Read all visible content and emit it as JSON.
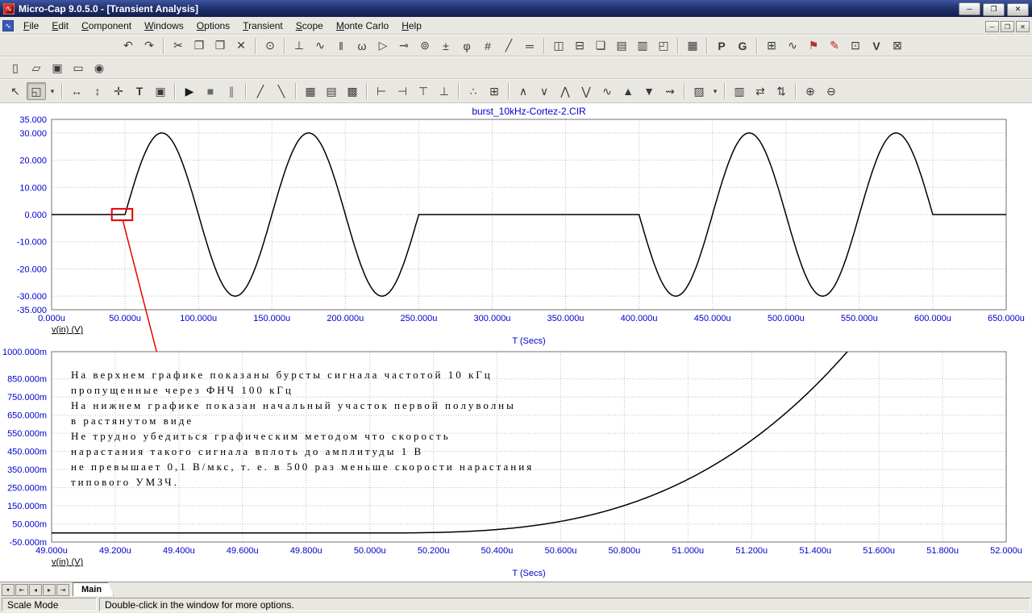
{
  "window": {
    "title": "Micro-Cap 9.0.5.0 - [Transient Analysis]",
    "icon_glyph": "∿",
    "mdi_icon_glyph": "∿",
    "controls": [
      {
        "name": "minimize",
        "glyph": "─"
      },
      {
        "name": "restore",
        "glyph": "❐"
      },
      {
        "name": "close",
        "glyph": "✕"
      }
    ],
    "mdi_controls": [
      {
        "name": "mdi-minimize",
        "glyph": "─"
      },
      {
        "name": "mdi-restore",
        "glyph": "❐"
      },
      {
        "name": "mdi-close",
        "glyph": "✕"
      }
    ]
  },
  "menubar": {
    "items": [
      "File",
      "Edit",
      "Component",
      "Windows",
      "Options",
      "Transient",
      "Scope",
      "Monte Carlo",
      "Help"
    ]
  },
  "toolbars": {
    "row1": [
      {
        "name": "undo",
        "glyph": "↶"
      },
      {
        "name": "redo",
        "glyph": "↷"
      },
      {
        "sep": true
      },
      {
        "name": "cut",
        "glyph": "✂"
      },
      {
        "name": "copy",
        "glyph": "❐"
      },
      {
        "name": "paste",
        "glyph": "❒"
      },
      {
        "name": "delete",
        "glyph": "✕"
      },
      {
        "sep": true
      },
      {
        "name": "find",
        "glyph": "⊙"
      },
      {
        "sep": true
      },
      {
        "name": "ground-component",
        "glyph": "⊥"
      },
      {
        "name": "resistor-component",
        "glyph": "∿"
      },
      {
        "name": "capacitor-component",
        "glyph": "‖"
      },
      {
        "name": "inductor-component",
        "glyph": "ω"
      },
      {
        "name": "diode-component",
        "glyph": "▷"
      },
      {
        "name": "transistor-component",
        "glyph": "⊸"
      },
      {
        "name": "source-component",
        "glyph": "⊚"
      },
      {
        "name": "battery-component",
        "glyph": "±"
      },
      {
        "name": "phase-component",
        "glyph": "φ"
      },
      {
        "name": "node-numbers",
        "glyph": "#"
      },
      {
        "name": "wire-mode",
        "glyph": "╱"
      },
      {
        "name": "bus-mode",
        "glyph": "═"
      },
      {
        "sep": true
      },
      {
        "name": "split-horizontal",
        "glyph": "◫"
      },
      {
        "name": "split-vertical",
        "glyph": "⊟"
      },
      {
        "name": "cascade-windows",
        "glyph": "❏"
      },
      {
        "name": "tile-horizontal",
        "glyph": "▤"
      },
      {
        "name": "tile-vertical",
        "glyph": "▥"
      },
      {
        "name": "arrange-windows",
        "glyph": "◰"
      },
      {
        "sep": true
      },
      {
        "name": "calculator",
        "glyph": "▦"
      },
      {
        "sep": true
      },
      {
        "name": "pspice-netlist",
        "glyph": "P",
        "bold": true
      },
      {
        "name": "go-to-flag",
        "glyph": "G",
        "bold": true
      },
      {
        "sep": true
      },
      {
        "name": "stepping",
        "glyph": "⊞"
      },
      {
        "name": "waveform-source",
        "glyph": "∿"
      },
      {
        "name": "flag-mode",
        "glyph": "⚑",
        "color": "#b03030"
      },
      {
        "name": "probe-pencil",
        "glyph": "✎",
        "color": "#c02020"
      },
      {
        "name": "scope-window",
        "glyph": "⊡"
      },
      {
        "name": "vi-plot",
        "glyph": "V",
        "bold": true
      },
      {
        "name": "animate-window",
        "glyph": "⊠"
      }
    ],
    "row2": [
      {
        "name": "new-file",
        "glyph": "▯"
      },
      {
        "name": "open-file",
        "glyph": "▱"
      },
      {
        "name": "save-file",
        "glyph": "▣"
      },
      {
        "name": "print",
        "glyph": "▭"
      },
      {
        "name": "print-preview",
        "glyph": "◉"
      }
    ],
    "row3": [
      {
        "name": "select-mode",
        "glyph": "↖"
      },
      {
        "name": "scale-mode",
        "glyph": "◱",
        "active": true
      },
      {
        "name": "mode-dropdown",
        "glyph": "▾",
        "narrow": true
      },
      {
        "sep": true
      },
      {
        "name": "horizontal-tag-mode",
        "glyph": "↔"
      },
      {
        "name": "vertical-tag-mode",
        "glyph": "↕"
      },
      {
        "name": "tag-mode",
        "glyph": "✛"
      },
      {
        "name": "text-mode",
        "glyph": "T",
        "bold": true
      },
      {
        "name": "properties",
        "glyph": "▣"
      },
      {
        "sep": true
      },
      {
        "name": "run",
        "glyph": "▶",
        "color": "#1a1a1a"
      },
      {
        "name": "stop",
        "glyph": "■",
        "color": "#6b6b6b"
      },
      {
        "name": "pause",
        "glyph": "∥",
        "color": "#6b6b6b"
      },
      {
        "sep": true
      },
      {
        "name": "line-mode",
        "glyph": "╱"
      },
      {
        "name": "diagonal-line-mode",
        "glyph": "╲"
      },
      {
        "sep": true
      },
      {
        "name": "grid-solid",
        "glyph": "▦"
      },
      {
        "name": "grid-horizontal",
        "glyph": "▤"
      },
      {
        "name": "grid-dots",
        "glyph": "▩"
      },
      {
        "sep": true
      },
      {
        "name": "cursor-left",
        "glyph": "⊢"
      },
      {
        "name": "cursor-right",
        "glyph": "⊣"
      },
      {
        "name": "cursor-top",
        "glyph": "⊤"
      },
      {
        "name": "cursor-bottom",
        "glyph": "⊥"
      },
      {
        "sep": true
      },
      {
        "name": "data-points",
        "glyph": "∴"
      },
      {
        "name": "token-display",
        "glyph": "⊞"
      },
      {
        "sep": true
      },
      {
        "name": "next-peak",
        "glyph": "∧"
      },
      {
        "name": "next-valley",
        "glyph": "∨"
      },
      {
        "name": "next-high",
        "glyph": "⋀"
      },
      {
        "name": "next-low",
        "glyph": "⋁"
      },
      {
        "name": "next-inflection",
        "glyph": "∿"
      },
      {
        "name": "global-high",
        "glyph": "▲"
      },
      {
        "name": "global-low",
        "glyph": "▼"
      },
      {
        "name": "go-to-branch",
        "glyph": "⇝"
      },
      {
        "sep": true
      },
      {
        "name": "trace-color",
        "glyph": "▨"
      },
      {
        "name": "color-dropdown",
        "glyph": "▾",
        "narrow": true
      },
      {
        "sep": true
      },
      {
        "name": "numeric-output",
        "glyph": "▥"
      },
      {
        "name": "auto-scale-horizontal",
        "glyph": "⇄"
      },
      {
        "name": "auto-scale-vertical",
        "glyph": "⇅"
      },
      {
        "sep": true
      },
      {
        "name": "zoom-in",
        "glyph": "⊕"
      },
      {
        "name": "zoom-out",
        "glyph": "⊖"
      }
    ]
  },
  "chart_data": [
    {
      "type": "line",
      "title": "burst_10kHz-Cortez-2.CIR",
      "trace": "v(in) (V)",
      "xlabel": "T (Secs)",
      "x_unit": "us",
      "y_unit": "V",
      "xlim": [
        0,
        650
      ],
      "ylim": [
        -35,
        35
      ],
      "trace_color": "#000000",
      "x_ticks": [
        {
          "v": 0,
          "label": "0.000u"
        },
        {
          "v": 50,
          "label": "50.000u"
        },
        {
          "v": 100,
          "label": "100.000u"
        },
        {
          "v": 150,
          "label": "150.000u"
        },
        {
          "v": 200,
          "label": "200.000u"
        },
        {
          "v": 250,
          "label": "250.000u"
        },
        {
          "v": 300,
          "label": "300.000u"
        },
        {
          "v": 350,
          "label": "350.000u"
        },
        {
          "v": 400,
          "label": "400.000u"
        },
        {
          "v": 450,
          "label": "450.000u"
        },
        {
          "v": 500,
          "label": "500.000u"
        },
        {
          "v": 550,
          "label": "550.000u"
        },
        {
          "v": 600,
          "label": "600.000u"
        },
        {
          "v": 650,
          "label": "650.000u"
        }
      ],
      "y_ticks": [
        {
          "v": 35,
          "label": "35.000"
        },
        {
          "v": 30,
          "label": "30.000"
        },
        {
          "v": 20,
          "label": "20.000"
        },
        {
          "v": 10,
          "label": "10.000"
        },
        {
          "v": 0,
          "label": "0.000"
        },
        {
          "v": -10,
          "label": "-10.000"
        },
        {
          "v": -20,
          "label": "-20.000"
        },
        {
          "v": -30,
          "label": "-30.000"
        },
        {
          "v": -35,
          "label": "-35.000"
        }
      ],
      "y_grid": [
        30,
        20,
        10,
        0,
        -10,
        -20,
        -30
      ],
      "signal": {
        "kind": "sine_bursts",
        "amplitude": 30,
        "period_us": 100,
        "bursts": [
          {
            "start": 50,
            "end": 250,
            "polarity": 1
          },
          {
            "start": 400,
            "end": 600,
            "polarity": -1
          }
        ]
      },
      "marker": {
        "color": "#e60000",
        "box": {
          "t1": 41,
          "t2": 55,
          "v1": -2.1,
          "v2": 2.1
        },
        "line": {
          "t1": 48.5,
          "v1": -2.1,
          "t2": 49.33
        }
      }
    },
    {
      "type": "line",
      "trace": "v(in) (V)",
      "xlabel": "T (Secs)",
      "x_unit": "us",
      "y_unit": "mV",
      "xlim": [
        49,
        52
      ],
      "ylim": [
        -50,
        1000
      ],
      "trace_color": "#000000",
      "x_ticks": [
        {
          "v": 49,
          "label": "49.000u"
        },
        {
          "v": 49.2,
          "label": "49.200u"
        },
        {
          "v": 49.4,
          "label": "49.400u"
        },
        {
          "v": 49.6,
          "label": "49.600u"
        },
        {
          "v": 49.8,
          "label": "49.800u"
        },
        {
          "v": 50,
          "label": "50.000u"
        },
        {
          "v": 50.2,
          "label": "50.200u"
        },
        {
          "v": 50.4,
          "label": "50.400u"
        },
        {
          "v": 50.6,
          "label": "50.600u"
        },
        {
          "v": 50.8,
          "label": "50.800u"
        },
        {
          "v": 51,
          "label": "51.000u"
        },
        {
          "v": 51.2,
          "label": "51.200u"
        },
        {
          "v": 51.4,
          "label": "51.400u"
        },
        {
          "v": 51.6,
          "label": "51.600u"
        },
        {
          "v": 51.8,
          "label": "51.800u"
        },
        {
          "v": 52,
          "label": "52.000u"
        }
      ],
      "y_ticks": [
        {
          "v": 1000,
          "label": "1000.000m"
        },
        {
          "v": 850,
          "label": "850.000m"
        },
        {
          "v": 750,
          "label": "750.000m"
        },
        {
          "v": 650,
          "label": "650.000m"
        },
        {
          "v": 550,
          "label": "550.000m"
        },
        {
          "v": 450,
          "label": "450.000m"
        },
        {
          "v": 350,
          "label": "350.000m"
        },
        {
          "v": 250,
          "label": "250.000m"
        },
        {
          "v": 150,
          "label": "150.000m"
        },
        {
          "v": 50,
          "label": "50.000m"
        },
        {
          "v": -50,
          "label": "-50.000m"
        }
      ],
      "y_grid": [
        850,
        750,
        650,
        550,
        450,
        350,
        250,
        150,
        50
      ],
      "signal": {
        "kind": "cubic_rise",
        "t0": 50,
        "coeff": 296
      }
    }
  ],
  "annotation": {
    "lines": [
      "На верхнем графике показаны бурсты сигнала частотой 10 кГц",
      "пропущенные через ФНЧ 100 кГц",
      "На нижнем графике показан начальный участок первой полуволны",
      "в растянутом виде",
      "Не трудно убедиться графическим методом что скорость",
      "нарастания такого сигнала вплоть до амплитуды 1 В",
      "не превышает 0,1 В/мкс, т. е. в 500 раз меньше скорости нарастания",
      "типового УМЗЧ."
    ]
  },
  "tabbar": {
    "nav": [
      {
        "name": "tab-list",
        "glyph": "▾"
      },
      {
        "name": "first-tab",
        "glyph": "⇤"
      },
      {
        "name": "prev-tab",
        "glyph": "◂"
      },
      {
        "name": "next-tab",
        "glyph": "▸"
      },
      {
        "name": "last-tab",
        "glyph": "⇥"
      }
    ],
    "tabs": [
      {
        "label": "Main",
        "active": true
      }
    ]
  },
  "statusbar": {
    "left": "Scale Mode",
    "right": "Double-click in the window for more options."
  }
}
